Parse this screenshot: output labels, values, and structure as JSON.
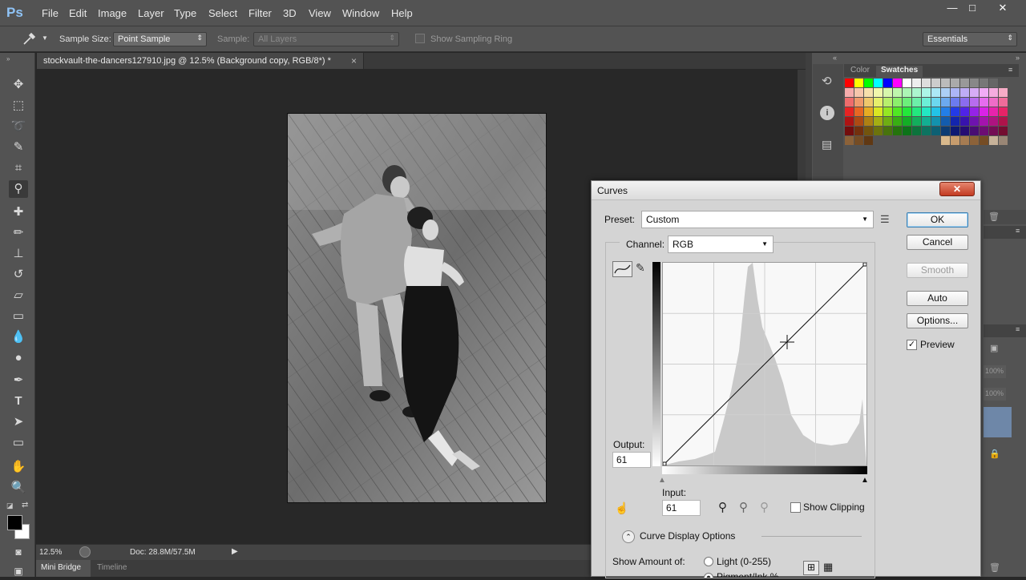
{
  "app": {
    "logo": "Ps"
  },
  "menu": [
    "File",
    "Edit",
    "Image",
    "Layer",
    "Type",
    "Select",
    "Filter",
    "3D",
    "View",
    "Window",
    "Help"
  ],
  "window_controls": {
    "minimize": "—",
    "maximize": "□",
    "close": "✕"
  },
  "options_bar": {
    "sample_size_label": "Sample Size:",
    "sample_size_value": "Point Sample",
    "sample_label": "Sample:",
    "sample_value": "All Layers",
    "show_sampling_ring": "Show Sampling Ring",
    "workspace": "Essentials"
  },
  "document": {
    "tab_title": "stockvault-the-dancers127910.jpg @ 12.5% (Background copy, RGB/8*) *",
    "close": "×"
  },
  "status": {
    "zoom": "12.5%",
    "doc_size": "Doc: 28.8M/57.5M"
  },
  "bottom_tabs": [
    "Mini Bridge",
    "Timeline"
  ],
  "right_panel": {
    "tabs": [
      "Color",
      "Swatches"
    ],
    "zoom_a": "100%",
    "zoom_b": "100%"
  },
  "curves": {
    "title": "Curves",
    "close": "✕",
    "preset_label": "Preset:",
    "preset_value": "Custom",
    "channel_label": "Channel:",
    "channel_value": "RGB",
    "output_label": "Output:",
    "output_value": "61",
    "input_label": "Input:",
    "input_value": "61",
    "show_clipping": "Show Clipping",
    "curve_display_options": "Curve Display Options",
    "show_amount_label": "Show Amount of:",
    "light_option": "Light  (0-255)",
    "pigment_option": "Pigment/Ink %",
    "buttons": {
      "ok": "OK",
      "cancel": "Cancel",
      "smooth": "Smooth",
      "auto": "Auto",
      "options": "Options..."
    },
    "preview_label": "Preview",
    "preview_checked": true
  },
  "colors": {
    "accent": "#3c7fb1",
    "ps_blue": "#8fc3f6",
    "ui_bg": "#535353",
    "canvas_bg": "#282828"
  }
}
